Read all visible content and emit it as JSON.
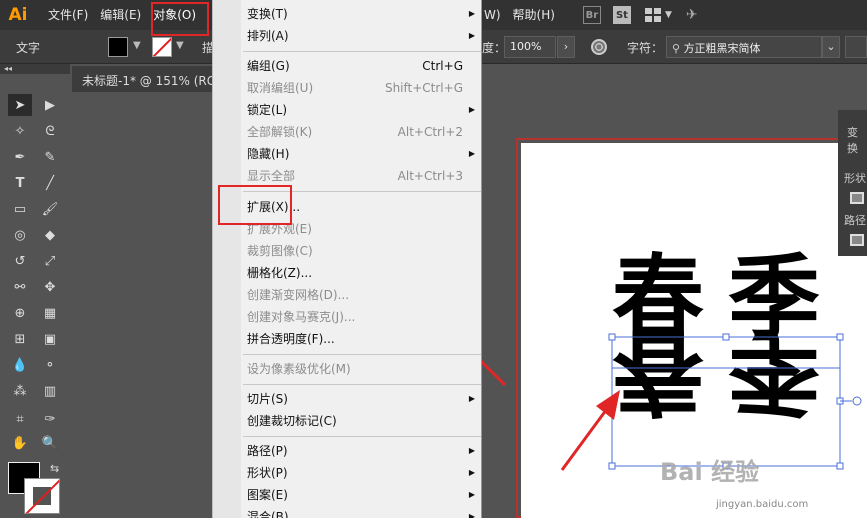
{
  "menubar": {
    "logo": "Ai",
    "items": [
      "文件(F)",
      "编辑(E)",
      "对象(O)"
    ],
    "right_items": [
      "W)",
      "帮助(H)"
    ],
    "br": "Br",
    "st": "St"
  },
  "control": {
    "label": "文字",
    "trunc": "描",
    "opacity_label": "度：",
    "opacity_value": "100%",
    "char_label": "字符：",
    "font_value": "方正粗黑宋简体"
  },
  "doc_tab": "未标题-1* @ 151% (RG",
  "right_panel": {
    "title": "变换",
    "shape": "形状",
    "path": "路径"
  },
  "menu": {
    "items": [
      {
        "label": "变换(T)",
        "shortcut": "",
        "submenu": true,
        "disabled": false
      },
      {
        "label": "排列(A)",
        "shortcut": "",
        "submenu": true,
        "disabled": false
      },
      {
        "label": "编组(G)",
        "shortcut": "Ctrl+G",
        "submenu": false,
        "disabled": false
      },
      {
        "label": "取消编组(U)",
        "shortcut": "Shift+Ctrl+G",
        "submenu": false,
        "disabled": true
      },
      {
        "label": "锁定(L)",
        "shortcut": "",
        "submenu": true,
        "disabled": false
      },
      {
        "label": "全部解锁(K)",
        "shortcut": "Alt+Ctrl+2",
        "submenu": false,
        "disabled": true
      },
      {
        "label": "隐藏(H)",
        "shortcut": "",
        "submenu": true,
        "disabled": false
      },
      {
        "label": "显示全部",
        "shortcut": "Alt+Ctrl+3",
        "submenu": false,
        "disabled": true
      },
      {
        "label": "扩展(X)...",
        "shortcut": "",
        "submenu": false,
        "disabled": false
      },
      {
        "label": "扩展外观(E)",
        "shortcut": "",
        "submenu": false,
        "disabled": true
      },
      {
        "label": "裁剪图像(C)",
        "shortcut": "",
        "submenu": false,
        "disabled": true
      },
      {
        "label": "栅格化(Z)...",
        "shortcut": "",
        "submenu": false,
        "disabled": false
      },
      {
        "label": "创建渐变网格(D)...",
        "shortcut": "",
        "submenu": false,
        "disabled": true
      },
      {
        "label": "创建对象马赛克(J)...",
        "shortcut": "",
        "submenu": false,
        "disabled": true
      },
      {
        "label": "拼合透明度(F)...",
        "shortcut": "",
        "submenu": false,
        "disabled": false
      },
      {
        "label": "设为像素级优化(M)",
        "shortcut": "",
        "submenu": false,
        "disabled": true
      },
      {
        "label": "切片(S)",
        "shortcut": "",
        "submenu": true,
        "disabled": false
      },
      {
        "label": "创建裁切标记(C)",
        "shortcut": "",
        "submenu": false,
        "disabled": false
      },
      {
        "label": "路径(P)",
        "shortcut": "",
        "submenu": true,
        "disabled": false
      },
      {
        "label": "形状(P)",
        "shortcut": "",
        "submenu": true,
        "disabled": false
      },
      {
        "label": "图案(E)",
        "shortcut": "",
        "submenu": true,
        "disabled": false
      },
      {
        "label": "混合(B)",
        "shortcut": "",
        "submenu": true,
        "disabled": false
      }
    ]
  },
  "artwork": {
    "text_top": [
      "春",
      "季"
    ],
    "text_reflect": [
      "春",
      "季"
    ]
  },
  "watermark": {
    "text": "Bai 经验",
    "url": "jingyan.baidu.com"
  },
  "colors": {
    "accent_red": "#e02626",
    "selection_blue": "#4a6fd8",
    "ai_orange": "#ff9a00"
  }
}
